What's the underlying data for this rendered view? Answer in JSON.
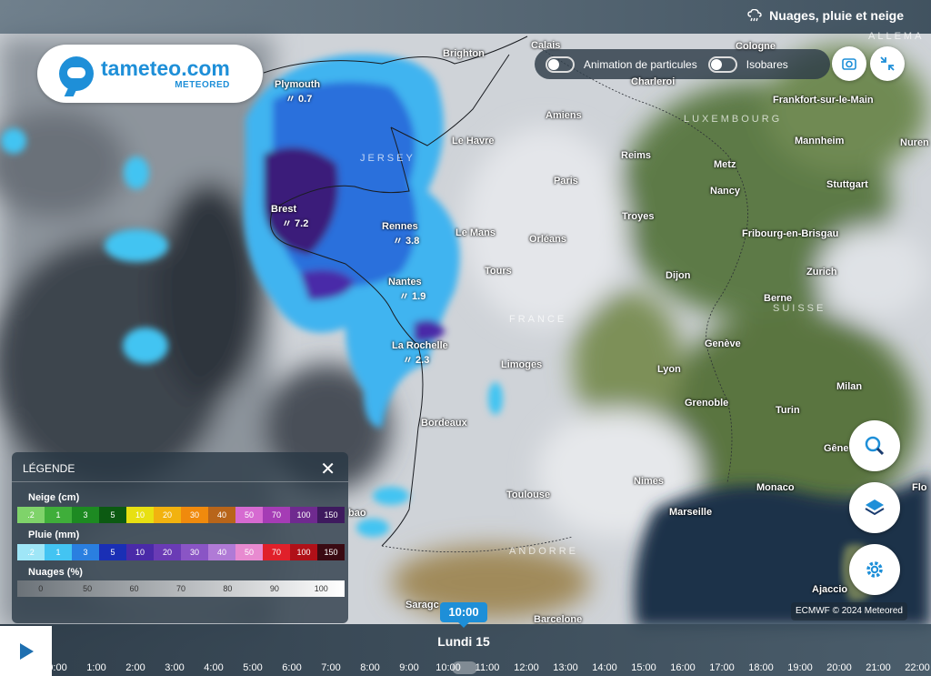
{
  "header": {
    "layer_title": "Nuages, pluie et neige"
  },
  "logo": {
    "name": "tameteo.com",
    "sub": "METEORED"
  },
  "controls": {
    "particles_label": "Animation de particules",
    "isobars_label": "Isobares"
  },
  "cities": [
    {
      "name": "Brighton"
    },
    {
      "name": "Calais"
    },
    {
      "name": "Cologne"
    },
    {
      "name": "Plymouth",
      "precip": "0.7"
    },
    {
      "name": "Charleroi"
    },
    {
      "name": "Amiens"
    },
    {
      "name": "Frankfort-sur-le-Main"
    },
    {
      "name": "Le Havre"
    },
    {
      "name": "Mannheim"
    },
    {
      "name": "Nuren"
    },
    {
      "name": "Reims"
    },
    {
      "name": "Metz"
    },
    {
      "name": "Paris"
    },
    {
      "name": "Stuttgart"
    },
    {
      "name": "Nancy"
    },
    {
      "name": "Brest",
      "precip": "7.2"
    },
    {
      "name": "Troyes"
    },
    {
      "name": "Rennes",
      "precip": "3.8"
    },
    {
      "name": "Le Mans"
    },
    {
      "name": "Orléans"
    },
    {
      "name": "Fribourg-en-Brisgau"
    },
    {
      "name": "Tours"
    },
    {
      "name": "Zurich"
    },
    {
      "name": "Dijon"
    },
    {
      "name": "Nantes",
      "precip": "1.9"
    },
    {
      "name": "Berne"
    },
    {
      "name": "Genève"
    },
    {
      "name": "La Rochelle",
      "precip": "2.3"
    },
    {
      "name": "Limoges"
    },
    {
      "name": "Lyon"
    },
    {
      "name": "Milan"
    },
    {
      "name": "Grenoble"
    },
    {
      "name": "Turin"
    },
    {
      "name": "Bordeaux"
    },
    {
      "name": "Gêne"
    },
    {
      "name": "Nimes"
    },
    {
      "name": "Toulouse"
    },
    {
      "name": "Monaco"
    },
    {
      "name": "Flo"
    },
    {
      "name": "Marseille"
    },
    {
      "name": "Ajaccio"
    },
    {
      "name": "Saragc"
    },
    {
      "name": "Barcelone"
    },
    {
      "name": "bao"
    }
  ],
  "country_labels": [
    "FRANCE",
    "SUISSE",
    "LUXEMBOURG",
    "JERSEY",
    "ANDORRE",
    "ALLEMA"
  ],
  "credit": "ECMWF © 2024 Meteored",
  "legend": {
    "title": "LÉGENDE",
    "snow_label": "Neige (cm)",
    "snow_ticks": [
      ".2",
      "1",
      "3",
      "5",
      "10",
      "20",
      "30",
      "40",
      "50",
      "70",
      "100",
      "150"
    ],
    "snow_colors": [
      "#7fd36a",
      "#3fae3a",
      "#1d8a22",
      "#0c5a12",
      "#e8e012",
      "#f2b20f",
      "#f08a0d",
      "#b8651a",
      "#d66ad1",
      "#a53cb5",
      "#6f2a8f",
      "#3e1a5e"
    ],
    "rain_label": "Pluie (mm)",
    "rain_ticks": [
      ".2",
      "1",
      "3",
      "5",
      "10",
      "20",
      "30",
      "40",
      "50",
      "70",
      "100",
      "150"
    ],
    "rain_colors": [
      "#9fe6f7",
      "#43c4f2",
      "#2a7fe0",
      "#1a2fb5",
      "#4a2aa8",
      "#6a3bb5",
      "#8a55c5",
      "#b07ad6",
      "#e88ad0",
      "#e0202a",
      "#b01018",
      "#3a0a12"
    ],
    "clouds_label": "Nuages (%)",
    "clouds_ticks": [
      "0",
      "50",
      "60",
      "70",
      "80",
      "90",
      "100"
    ]
  },
  "timeline": {
    "current_time": "10:00",
    "day": "Lundi 15",
    "hours": [
      "0:00",
      "1:00",
      "2:00",
      "3:00",
      "4:00",
      "5:00",
      "6:00",
      "7:00",
      "8:00",
      "9:00",
      "10:00",
      "11:00",
      "12:00",
      "13:00",
      "14:00",
      "15:00",
      "16:00",
      "17:00",
      "18:00",
      "19:00",
      "20:00",
      "21:00",
      "22:00"
    ]
  }
}
